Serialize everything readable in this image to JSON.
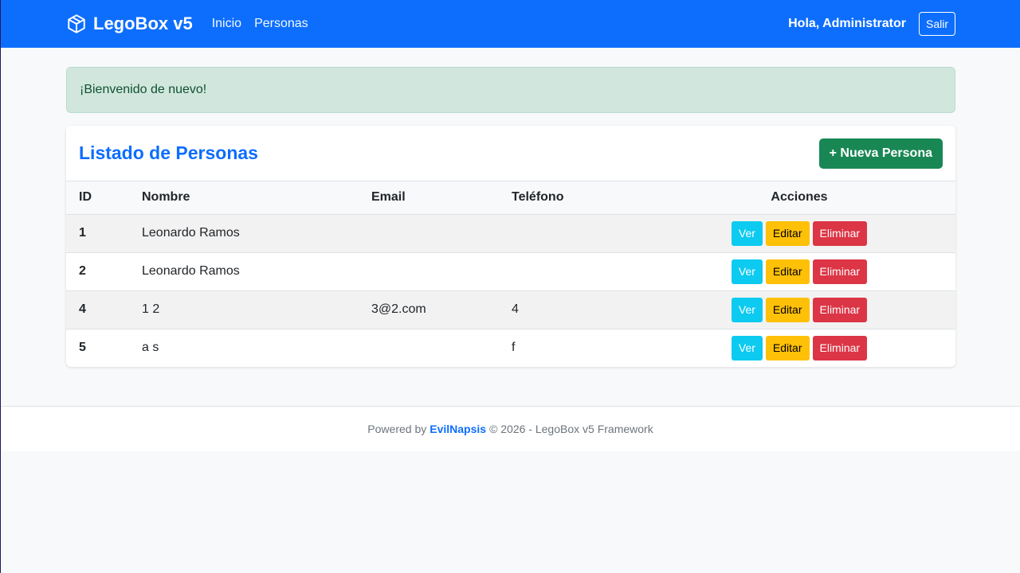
{
  "nav": {
    "brand": "LegoBox v5",
    "brand_icon": "box-icon",
    "links": [
      "Inicio",
      "Personas"
    ],
    "greeting": "Hola, Administrator",
    "logout": "Salir"
  },
  "alert": {
    "message": "¡Bienvenido de nuevo!"
  },
  "card": {
    "title": "Listado de Personas",
    "new_button": "+ Nueva Persona",
    "columns": [
      "ID",
      "Nombre",
      "Email",
      "Teléfono",
      "Acciones"
    ],
    "rows": [
      {
        "id": "1",
        "name": "Leonardo Ramos",
        "email": "",
        "phone": ""
      },
      {
        "id": "2",
        "name": "Leonardo Ramos",
        "email": "",
        "phone": ""
      },
      {
        "id": "4",
        "name": "1 2",
        "email": "3@2.com",
        "phone": "4"
      },
      {
        "id": "5",
        "name": "a s",
        "email": "",
        "phone": "f"
      }
    ],
    "actions": {
      "view": "Ver",
      "edit": "Editar",
      "delete": "Eliminar"
    }
  },
  "footer": {
    "prefix": "Powered by",
    "author": "EvilNapsis",
    "suffix": "© 2026 - LegoBox v5 Framework"
  },
  "colors": {
    "primary": "#0d6efd",
    "success": "#198754",
    "info": "#0dcaf0",
    "warning": "#ffc107",
    "danger": "#dc3545",
    "alert_bg": "#d1e7dd"
  }
}
